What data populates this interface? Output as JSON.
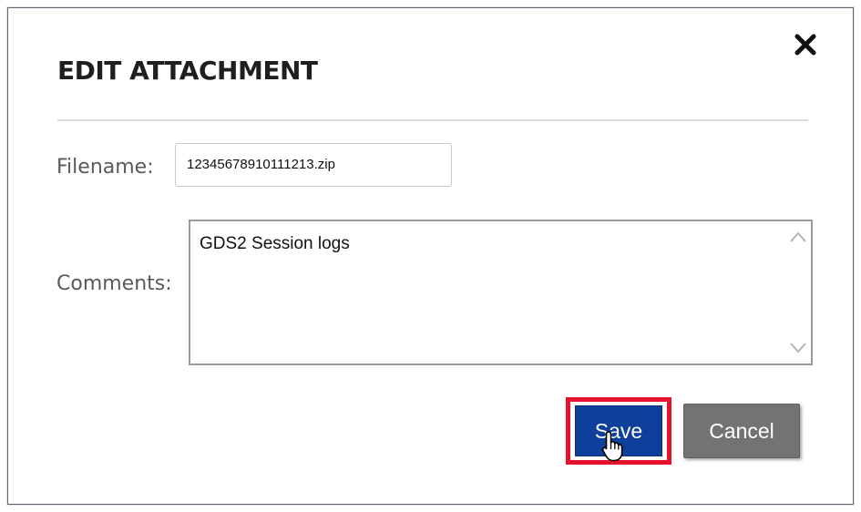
{
  "dialog": {
    "title": "EDIT ATTACHMENT",
    "close_icon": "close-icon"
  },
  "form": {
    "filename_label": "Filename:",
    "filename_value": "12345678910111213.zip",
    "comments_label": "Comments:",
    "comments_value": "GDS2 Session logs"
  },
  "buttons": {
    "save_label": "Save",
    "cancel_label": "Cancel"
  },
  "colors": {
    "save_button": "#0e3f9a",
    "cancel_button": "#737373",
    "highlight": "#e8112d"
  },
  "icons": {
    "close": "close-icon",
    "scroll_up": "chevron-up-icon",
    "scroll_down": "chevron-down-icon",
    "cursor": "hand-pointer-icon"
  }
}
